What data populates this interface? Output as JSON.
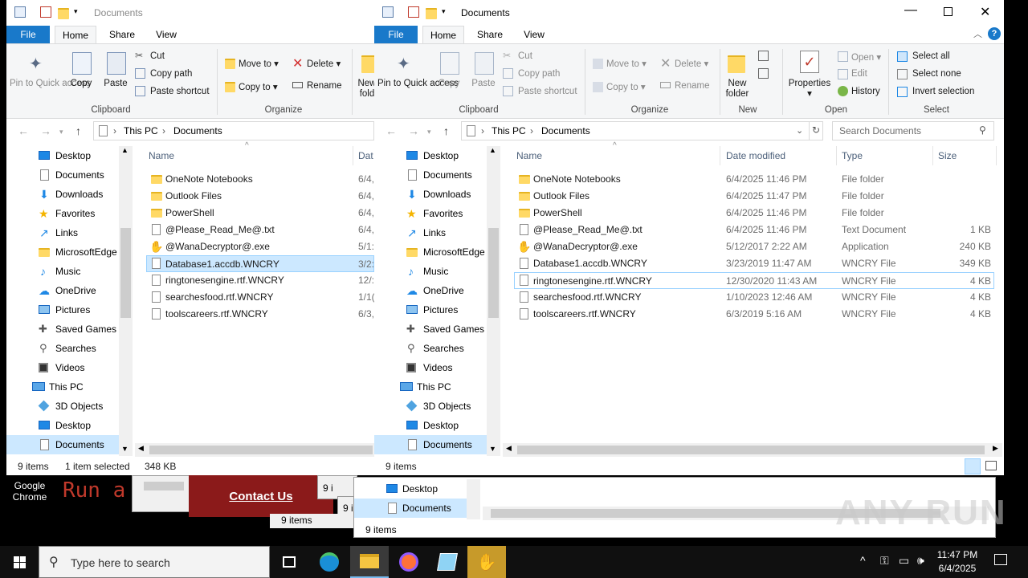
{
  "desktop": {
    "chrome_label": "Google Chrome",
    "run_text": "Run a",
    "contact_label": "Contact Us",
    "bg_items_1": "9 i",
    "bg_items_2": "9 i",
    "bg_items_3": "9 items",
    "bg_items_4": "9 items",
    "bg_nav_desktop": "Desktop",
    "bg_nav_documents": "Documents",
    "watermark": "ANY RUN"
  },
  "left_window": {
    "title": "Documents",
    "tabs": [
      "File",
      "Home",
      "Share",
      "View"
    ],
    "ribbon": {
      "pin": "Pin to Quick access",
      "copy": "Copy",
      "paste": "Paste",
      "cut": "Cut",
      "copy_path": "Copy path",
      "paste_shortcut": "Paste shortcut",
      "clipboard": "Clipboard",
      "move_to": "Move to",
      "copy_to": "Copy to",
      "delete": "Delete",
      "rename": "Rename",
      "organize": "Organize",
      "new_folder_partial": "New fold"
    },
    "breadcrumb": [
      "This PC",
      "Documents"
    ],
    "nav_items": [
      "Desktop",
      "Documents",
      "Downloads",
      "Favorites",
      "Links",
      "MicrosoftEdge",
      "Music",
      "OneDrive",
      "Pictures",
      "Saved Games",
      "Searches",
      "Videos",
      "This PC",
      "3D Objects",
      "Desktop",
      "Documents"
    ],
    "columns": {
      "name": "Name",
      "date": "Dat"
    },
    "rows": [
      {
        "name": "OneNote Notebooks",
        "date": "6/4,"
      },
      {
        "name": "Outlook Files",
        "date": "6/4,"
      },
      {
        "name": "PowerShell",
        "date": "6/4,"
      },
      {
        "name": "@Please_Read_Me@.txt",
        "date": "6/4,"
      },
      {
        "name": "@WanaDecryptor@.exe",
        "date": "5/1:"
      },
      {
        "name": "Database1.accdb.WNCRY",
        "date": "3/2:"
      },
      {
        "name": "ringtonesengine.rtf.WNCRY",
        "date": "12/:"
      },
      {
        "name": "searchesfood.rtf.WNCRY",
        "date": "1/1("
      },
      {
        "name": "toolscareers.rtf.WNCRY",
        "date": "6/3,"
      }
    ],
    "status_count": "9 items",
    "status_selected": "1 item selected",
    "status_size": "348 KB"
  },
  "right_window": {
    "title": "Documents",
    "tabs": [
      "File",
      "Home",
      "Share",
      "View"
    ],
    "ribbon": {
      "pin": "Pin to Quick access",
      "copy": "Copy",
      "paste": "Paste",
      "cut": "Cut",
      "copy_path": "Copy path",
      "paste_shortcut": "Paste shortcut",
      "clipboard": "Clipboard",
      "move_to": "Move to",
      "copy_to": "Copy to",
      "delete": "Delete",
      "rename": "Rename",
      "organize": "Organize",
      "new_folder": "New folder",
      "new": "New",
      "properties": "Properties",
      "open": "Open",
      "edit": "Edit",
      "history": "History",
      "open_group": "Open",
      "select_all": "Select all",
      "select_none": "Select none",
      "invert_selection": "Invert selection",
      "select_group": "Select"
    },
    "breadcrumb": [
      "This PC",
      "Documents"
    ],
    "search_placeholder": "Search Documents",
    "nav_items": [
      "Desktop",
      "Documents",
      "Downloads",
      "Favorites",
      "Links",
      "MicrosoftEdge",
      "Music",
      "OneDrive",
      "Pictures",
      "Saved Games",
      "Searches",
      "Videos",
      "This PC",
      "3D Objects",
      "Desktop",
      "Documents"
    ],
    "columns": {
      "name": "Name",
      "date": "Date modified",
      "type": "Type",
      "size": "Size"
    },
    "rows": [
      {
        "name": "OneNote Notebooks",
        "date": "6/4/2025 11:46 PM",
        "type": "File folder",
        "size": ""
      },
      {
        "name": "Outlook Files",
        "date": "6/4/2025 11:47 PM",
        "type": "File folder",
        "size": ""
      },
      {
        "name": "PowerShell",
        "date": "6/4/2025 11:46 PM",
        "type": "File folder",
        "size": ""
      },
      {
        "name": "@Please_Read_Me@.txt",
        "date": "6/4/2025 11:46 PM",
        "type": "Text Document",
        "size": "1 KB"
      },
      {
        "name": "@WanaDecryptor@.exe",
        "date": "5/12/2017 2:22 AM",
        "type": "Application",
        "size": "240 KB"
      },
      {
        "name": "Database1.accdb.WNCRY",
        "date": "3/23/2019 11:47 AM",
        "type": "WNCRY File",
        "size": "349 KB"
      },
      {
        "name": "ringtonesengine.rtf.WNCRY",
        "date": "12/30/2020 11:43 AM",
        "type": "WNCRY File",
        "size": "4 KB"
      },
      {
        "name": "searchesfood.rtf.WNCRY",
        "date": "1/10/2023 12:46 AM",
        "type": "WNCRY File",
        "size": "4 KB"
      },
      {
        "name": "toolscareers.rtf.WNCRY",
        "date": "6/3/2019 5:16 AM",
        "type": "WNCRY File",
        "size": "4 KB"
      }
    ],
    "status_count": "9 items"
  },
  "taskbar": {
    "search_placeholder": "Type here to search",
    "time": "11:47 PM",
    "date": "6/4/2025"
  },
  "colors": {
    "accent": "#1979ca",
    "selection": "#cce8ff",
    "taskbar": "#101010"
  }
}
